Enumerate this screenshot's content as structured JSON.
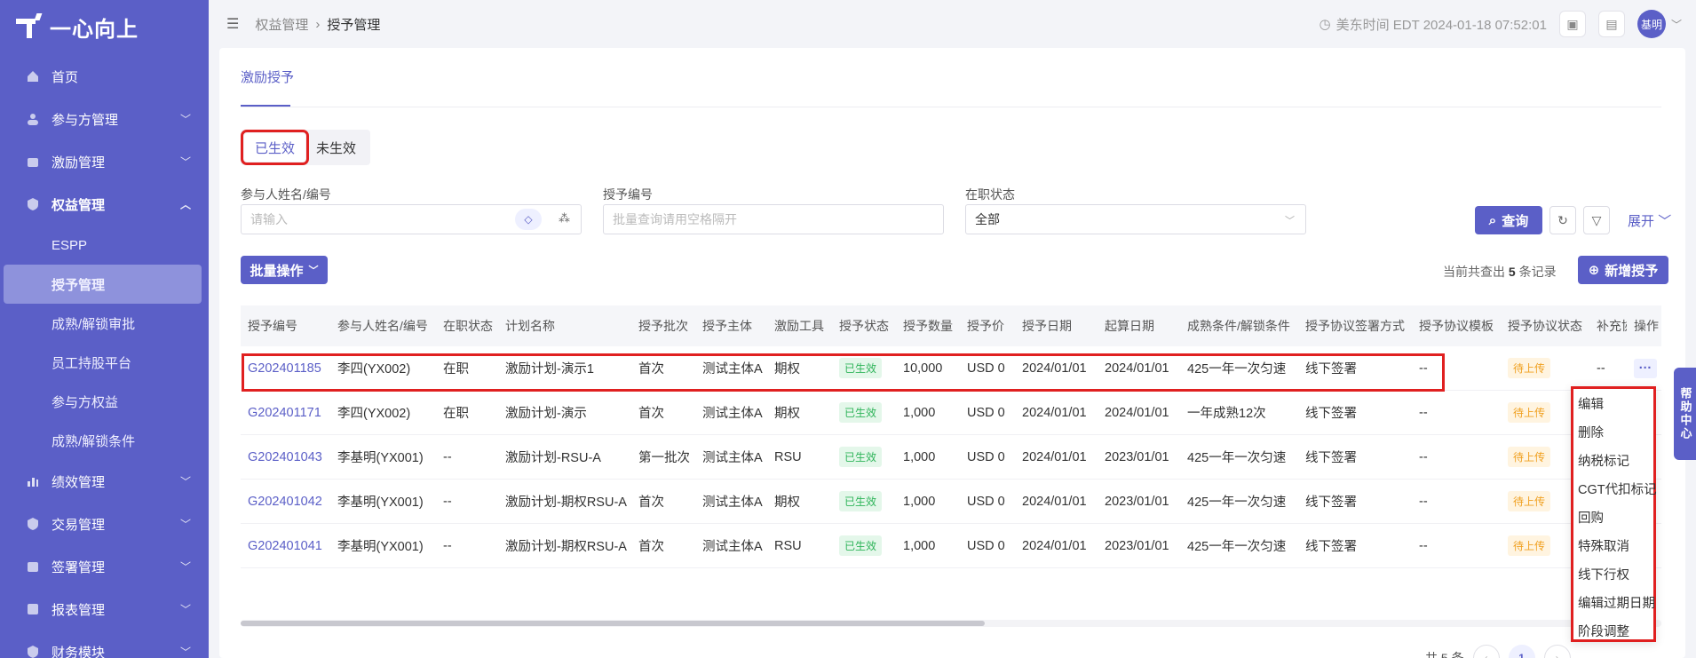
{
  "brand": {
    "name": "一心向上"
  },
  "sidebar": {
    "items": [
      {
        "label": "首页",
        "icon": "home-icon"
      },
      {
        "label": "参与方管理",
        "icon": "users-icon",
        "expandable": true
      },
      {
        "label": "激励管理",
        "icon": "gift-icon",
        "expandable": true
      },
      {
        "label": "权益管理",
        "icon": "shield-icon",
        "expandable": true,
        "expanded": true
      },
      {
        "label": "绩效管理",
        "icon": "chart-icon",
        "expandable": true
      },
      {
        "label": "交易管理",
        "icon": "exchange-icon",
        "expandable": true
      },
      {
        "label": "签署管理",
        "icon": "pen-icon",
        "expandable": true
      },
      {
        "label": "报表管理",
        "icon": "report-icon",
        "expandable": true
      },
      {
        "label": "财务模块",
        "icon": "finance-icon",
        "expandable": true
      }
    ],
    "subitems": [
      "ESPP",
      "授予管理",
      "成熟/解锁审批",
      "员工持股平台",
      "参与方权益",
      "成熟/解锁条件"
    ],
    "active_sub": "授予管理"
  },
  "header": {
    "breadcrumb": [
      "权益管理",
      "授予管理"
    ],
    "clock": "美东时间 EDT 2024-01-18 07:52:01",
    "avatar": "基明"
  },
  "page": {
    "tab": "激励授予",
    "segments": [
      "已生效",
      "未生效"
    ],
    "active_segment": "已生效"
  },
  "filters": {
    "name_label": "参与人姓名/编号",
    "name_placeholder": "请输入",
    "grant_label": "授予编号",
    "grant_placeholder": "批量查询请用空格隔开",
    "status_label": "在职状态",
    "status_value": "全部",
    "query_button": "查询",
    "expand_label": "展开"
  },
  "toolbar": {
    "batch_label": "批量操作",
    "count_prefix": "当前共查出",
    "count_value": "5",
    "count_suffix": "条记录",
    "add_label": "新增授予"
  },
  "table": {
    "headers": [
      "授予编号",
      "参与人姓名/编号",
      "在职状态",
      "计划名称",
      "授予批次",
      "授予主体",
      "激励工具",
      "授予状态",
      "授予数量",
      "授予价",
      "授予日期",
      "起算日期",
      "成熟条件/解锁条件",
      "授予协议签署方式",
      "授予协议模板",
      "授予协议状态",
      "补充协",
      "操作"
    ],
    "rows": [
      [
        "G202401185",
        "李四(YX002)",
        "在职",
        "激励计划-演示1",
        "首次",
        "测试主体A",
        "期权",
        "已生效",
        "10,000",
        "USD  0",
        "2024/01/01",
        "2024/01/01",
        "425一年一次匀速",
        "线下签署",
        "--",
        "待上传",
        "--",
        "···"
      ],
      [
        "G202401171",
        "李四(YX002)",
        "在职",
        "激励计划-演示",
        "首次",
        "测试主体A",
        "期权",
        "已生效",
        "1,000",
        "USD  0",
        "2024/01/01",
        "2024/01/01",
        "一年成熟12次",
        "线下签署",
        "--",
        "待上传",
        "",
        ""
      ],
      [
        "G202401043",
        "李基明(YX001)",
        "--",
        "激励计划-RSU-A",
        "第一批次",
        "测试主体A",
        "RSU",
        "已生效",
        "1,000",
        "USD  0",
        "2024/01/01",
        "2023/01/01",
        "425一年一次匀速",
        "线下签署",
        "--",
        "待上传",
        "",
        ""
      ],
      [
        "G202401042",
        "李基明(YX001)",
        "--",
        "激励计划-期权RSU-A",
        "首次",
        "测试主体A",
        "期权",
        "已生效",
        "1,000",
        "USD  0",
        "2024/01/01",
        "2023/01/01",
        "425一年一次匀速",
        "线下签署",
        "--",
        "待上传",
        "",
        ""
      ],
      [
        "G202401041",
        "李基明(YX001)",
        "--",
        "激励计划-期权RSU-A",
        "首次",
        "测试主体A",
        "RSU",
        "已生效",
        "1,000",
        "USD  0",
        "2024/01/01",
        "2023/01/01",
        "425一年一次匀速",
        "线下签署",
        "--",
        "待上传",
        "",
        ""
      ]
    ]
  },
  "pagination": {
    "total": "共 5 条",
    "current": "1"
  },
  "action_menu": {
    "items": [
      "编辑",
      "删除",
      "纳税标记",
      "CGT代扣标记",
      "回购",
      "特殊取消",
      "线下行权",
      "编辑过期日期",
      "阶段调整"
    ]
  },
  "help": {
    "label": "帮助中心"
  },
  "colors": {
    "brand": "#5b5fc7",
    "highlight": "#e02020",
    "ok": "#2fb45a",
    "wait": "#f0a020"
  }
}
